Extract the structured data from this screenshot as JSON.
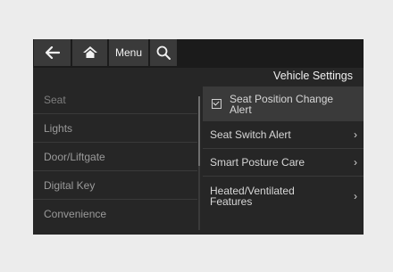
{
  "toolbar": {
    "back_icon": "arrow-left-icon",
    "home_icon": "home-icon",
    "menu_label": "Menu",
    "search_icon": "search-icon"
  },
  "header": {
    "title": "Vehicle Settings"
  },
  "left_menu": {
    "items": [
      "Seat",
      "Lights",
      "Door/Liftgate",
      "Digital Key",
      "Convenience"
    ],
    "selected": "Seat"
  },
  "right_menu": {
    "checkbox_item": {
      "label": "Seat Position Change Alert",
      "checked": true
    },
    "items": [
      {
        "label": "Seat Switch Alert",
        "chevron": "›"
      },
      {
        "label": "Smart Posture Care",
        "chevron": "›"
      },
      {
        "label": "Heated/Ventilated Features",
        "chevron": "›"
      }
    ]
  },
  "colors": {
    "screen_bg": "#262626",
    "button_bg": "#3a3a3a",
    "page_bg": "#ececec"
  }
}
